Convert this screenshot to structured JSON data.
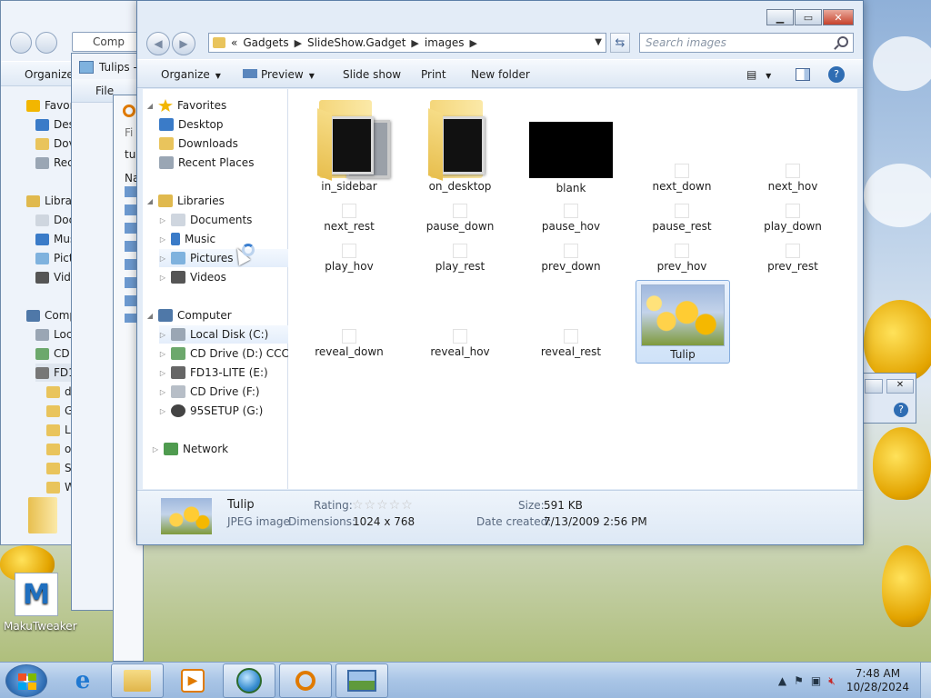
{
  "bg_window_computer": {
    "address_text": "Comp",
    "command": "Organize",
    "nav": [
      "Favor",
      "Des",
      "Dov",
      "Rec",
      "Libra",
      "Doc",
      "Mus",
      "Pict",
      "Vid",
      "Compu",
      "Loc",
      "CD",
      "FD1",
      "d",
      "G",
      "L(",
      "o",
      "S",
      "W"
    ]
  },
  "bg_window_tulips": {
    "title": "Tulips -",
    "menu": "File",
    "fields": [
      "Fi",
      "tu",
      "Na"
    ]
  },
  "explorer": {
    "breadcrumb": [
      "«",
      "Gadgets",
      "SlideShow.Gadget",
      "images"
    ],
    "search_placeholder": "Search images",
    "commands": {
      "organize": "Organize",
      "preview": "Preview",
      "slideshow": "Slide show",
      "print": "Print",
      "new_folder": "New folder"
    },
    "nav": {
      "favorites": "Favorites",
      "desktop": "Desktop",
      "downloads": "Downloads",
      "recent": "Recent Places",
      "libraries": "Libraries",
      "documents": "Documents",
      "music": "Music",
      "pictures": "Pictures",
      "videos": "Videos",
      "computer": "Computer",
      "local_disk": "Local Disk (C:)",
      "cd_d": "CD Drive (D:) CCCOI",
      "fd13": "FD13-LITE (E:)",
      "cd_f": "CD Drive (F:)",
      "setup": "95SETUP (G:)",
      "network": "Network"
    },
    "files": {
      "in_sidebar": "in_sidebar",
      "on_desktop": "on_desktop",
      "blank": "blank",
      "next_down": "next_down",
      "next_hov": "next_hov",
      "next_rest": "next_rest",
      "pause_down": "pause_down",
      "pause_hov": "pause_hov",
      "pause_rest": "pause_rest",
      "play_down": "play_down",
      "play_hov": "play_hov",
      "play_rest": "play_rest",
      "prev_down": "prev_down",
      "prev_hov": "prev_hov",
      "prev_rest": "prev_rest",
      "reveal_down": "reveal_down",
      "reveal_hov": "reveal_hov",
      "reveal_rest": "reveal_rest",
      "tulip": "Tulip"
    },
    "details": {
      "name": "Tulip",
      "type": "JPEG image",
      "rating_label": "Rating:",
      "rating_value": 0,
      "dimensions_label": "Dimensions:",
      "dimensions": "1024 x 768",
      "size_label": "Size:",
      "size": "591 KB",
      "date_label": "Date created:",
      "date": "7/13/2009 2:56 PM"
    }
  },
  "desktop_icon": "MakuTweaker",
  "clock": {
    "time": "7:48 AM",
    "date": "10/28/2024"
  },
  "colors": {
    "accent": "#3b7fd0",
    "selection": "#cfe2f8",
    "folder": "#f4d67a"
  }
}
